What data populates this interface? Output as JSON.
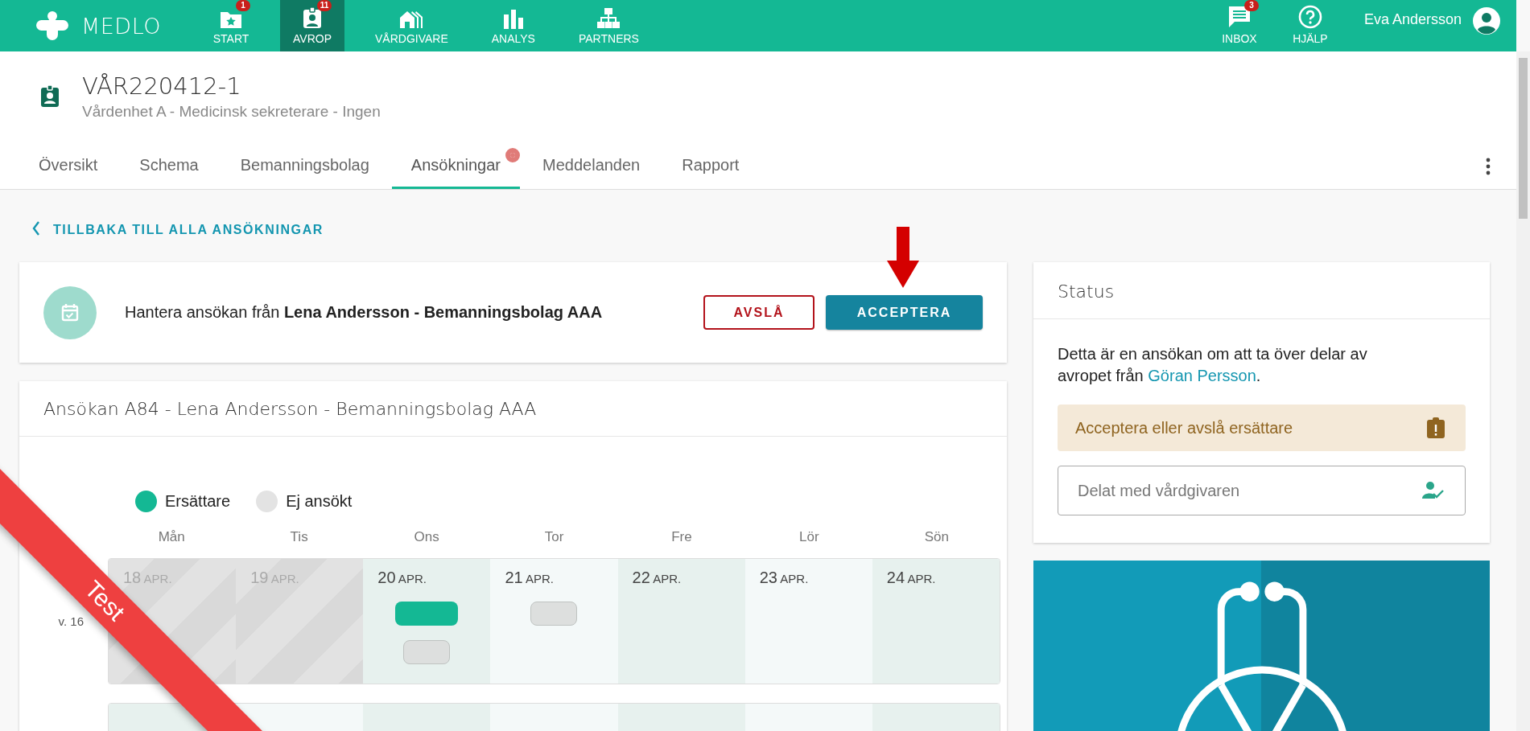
{
  "top_bar": {
    "logo": "MEDLO",
    "nav": [
      {
        "label": "START",
        "badge": "1",
        "selected": false
      },
      {
        "label": "AVROP",
        "badge": "11",
        "selected": true
      },
      {
        "label": "VÅRDGIVARE",
        "selected": false
      },
      {
        "label": "ANALYS",
        "selected": false
      },
      {
        "label": "PARTNERS",
        "selected": false
      }
    ],
    "right_nav": [
      {
        "label": "INBOX",
        "badge": "3"
      },
      {
        "label": "HJÄLP"
      }
    ],
    "user": "Eva Andersson"
  },
  "header": {
    "title": "VÅR220412-1",
    "subtitle": "Vårdenhet A - Medicinsk sekreterare - Ingen"
  },
  "tabs": [
    {
      "label": "Översikt",
      "selected": false,
      "dot": false
    },
    {
      "label": "Schema",
      "selected": false,
      "dot": false
    },
    {
      "label": "Bemanningsbolag",
      "selected": false,
      "dot": false
    },
    {
      "label": "Ansökningar",
      "selected": true,
      "dot": true
    },
    {
      "label": "Meddelanden",
      "selected": false,
      "dot": false
    },
    {
      "label": "Rapport",
      "selected": false,
      "dot": false
    }
  ],
  "back_link": "TILLBAKA TILL ALLA ANSÖKNINGAR",
  "action_card": {
    "text": "Hantera ansökan från **Lena Andersson - Bemanningsbolag AAA**",
    "reject": "AVSLÅ",
    "accept": "ACCEPTERA"
  },
  "application": {
    "title": "Ansökan A84 - Lena Andersson - Bemanningsbolag AAA",
    "legend": [
      {
        "label": "Ersättare",
        "color": "#14b894"
      },
      {
        "label": "Ej ansökt",
        "color": "#e3e3e3"
      }
    ],
    "weekdays": [
      "Mån",
      "Tis",
      "Ons",
      "Tor",
      "Fre",
      "Lör",
      "Sön"
    ],
    "weeks": [
      {
        "label": "v. 16",
        "days": [
          {
            "day": "18",
            "month": "APR.",
            "past": true
          },
          {
            "day": "19",
            "month": "APR.",
            "past": true
          },
          {
            "day": "20",
            "month": "APR.",
            "past": false,
            "shifts": [
              {
                "kind": "ersattare"
              },
              {
                "kind": "ej_ansokt"
              }
            ]
          },
          {
            "day": "21",
            "month": "APR.",
            "past": false,
            "shifts": [
              {
                "kind": "ej_ansokt"
              }
            ]
          },
          {
            "day": "22",
            "month": "APR.",
            "past": false
          },
          {
            "day": "23",
            "month": "APR.",
            "past": false
          },
          {
            "day": "24",
            "month": "APR.",
            "past": false
          }
        ]
      }
    ]
  },
  "status": {
    "title": "Status",
    "text": "Detta är en ansökan om att ta över delar av avropet från ",
    "link": "Göran Persson",
    "text_end": ".",
    "alert": "Acceptera eller avslå ersättare",
    "field_placeholder": "Delat med vårdgivaren"
  },
  "ribbon": "Test"
}
